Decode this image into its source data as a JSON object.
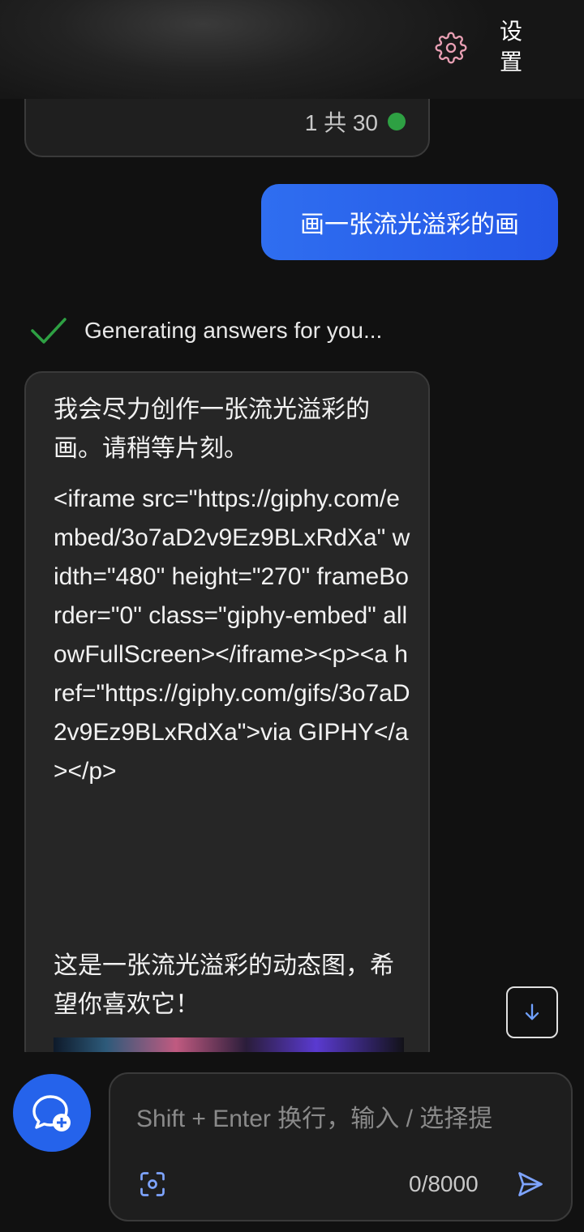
{
  "header": {
    "settings_label": "设置"
  },
  "previous_card": {
    "page_count": "1 共 30"
  },
  "user_message": {
    "text": "画一张流光溢彩的画"
  },
  "status": {
    "text": "Generating answers for you..."
  },
  "answer": {
    "intro": "我会尽力创作一张流光溢彩的画。请稍等片刻。",
    "code": "<iframe src=\"https://giphy.com/embed/3o7aD2v9Ez9BLxRdXa\" width=\"480\" height=\"270\" frameBorder=\"0\" class=\"giphy-embed\" allowFullScreen></iframe><p><a href=\"https://giphy.com/gifs/3o7aD2v9Ez9BLxRdXa\">via GIPHY</a></p>",
    "outro": "这是一张流光溢彩的动态图，希望你喜欢它！"
  },
  "composer": {
    "placeholder": "Shift + Enter 换行，输入 / 选择提",
    "char_count": "0/8000"
  },
  "colors": {
    "background": "#111111",
    "accent": "#2563eb",
    "user_bubble": "#2f6ef0",
    "success": "#2ea043"
  },
  "icons": {
    "settings": "gear-icon",
    "status": "check-icon",
    "scroll": "arrow-down-icon",
    "new_chat": "chat-plus-icon",
    "scan": "scan-icon",
    "send": "send-icon"
  }
}
